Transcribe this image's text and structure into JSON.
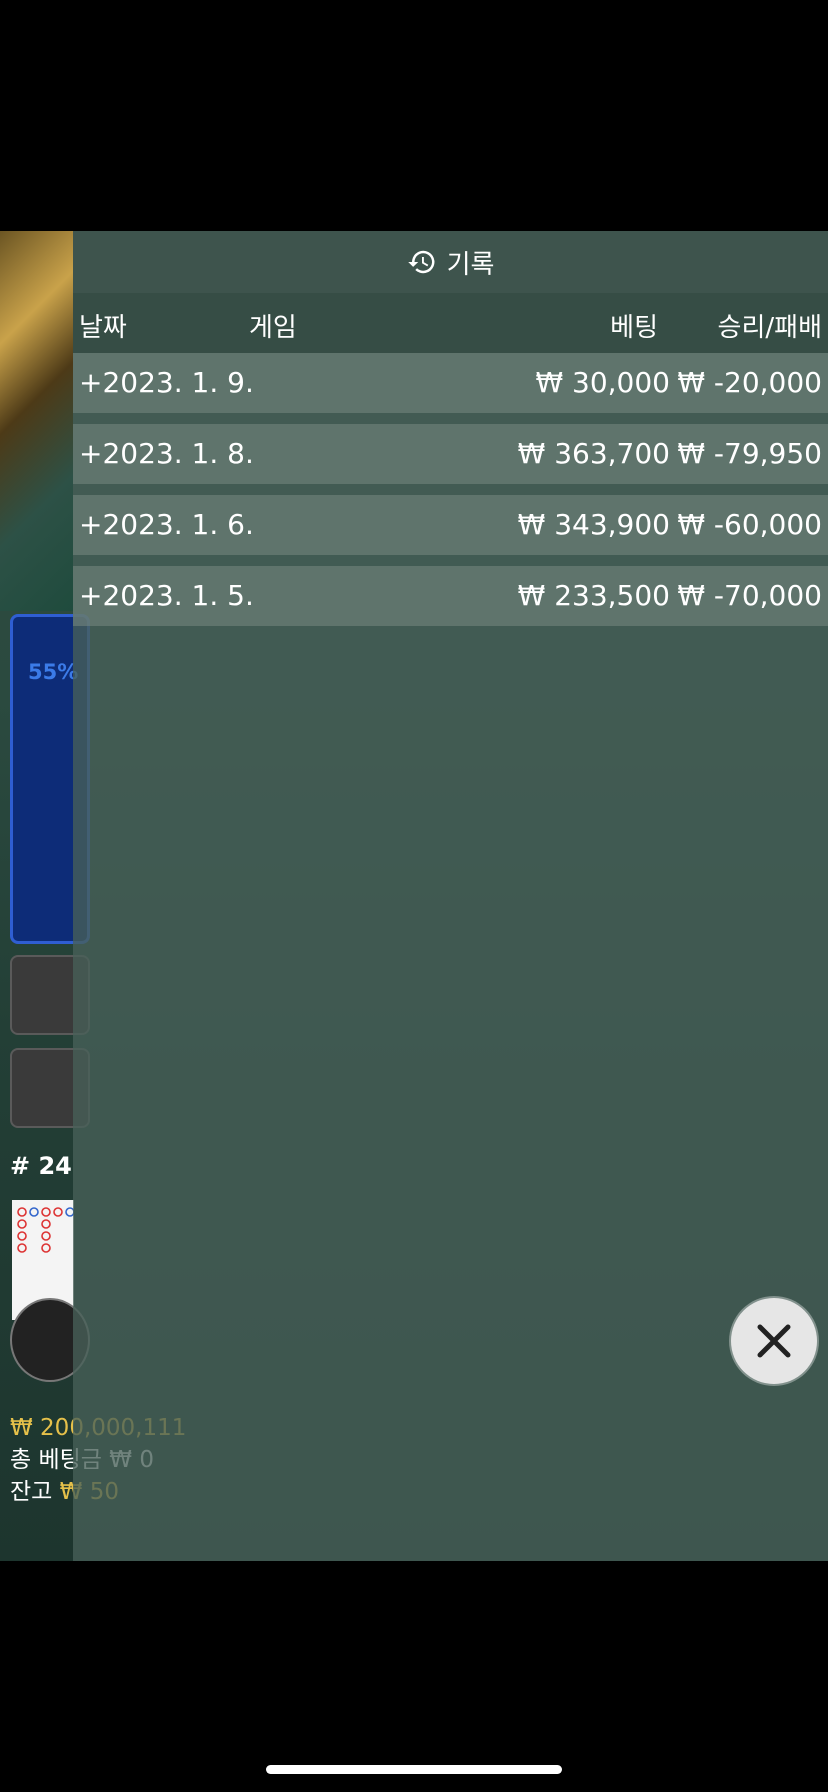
{
  "panel": {
    "title": "기록",
    "icon": "history-icon"
  },
  "table": {
    "headers": {
      "date": "날짜",
      "game": "게임",
      "bet": "베팅",
      "result": "승리/패배"
    },
    "rows": [
      {
        "date": "+2023. 1. 9.",
        "bet": "₩ 30,000",
        "result": "₩ -20,000"
      },
      {
        "date": "+2023. 1. 8.",
        "bet": "₩ 363,700",
        "result": "₩ -79,950"
      },
      {
        "date": "+2023. 1. 6.",
        "bet": "₩ 343,900",
        "result": "₩ -60,000"
      },
      {
        "date": "+2023. 1. 5.",
        "bet": "₩ 233,500",
        "result": "₩ -70,000"
      }
    ]
  },
  "background": {
    "player_percent": "55%",
    "round": "# 24",
    "balance_line1": "₩ 200,000,111",
    "balance_line2": "총 베팅금 ₩ 0",
    "balance_label": "잔고",
    "balance_value": "₩ 50"
  },
  "colors": {
    "gold": "#e5c04a",
    "player_blue": "#0d2c78",
    "overlay": "#486058"
  },
  "close": {
    "icon": "close-icon"
  }
}
